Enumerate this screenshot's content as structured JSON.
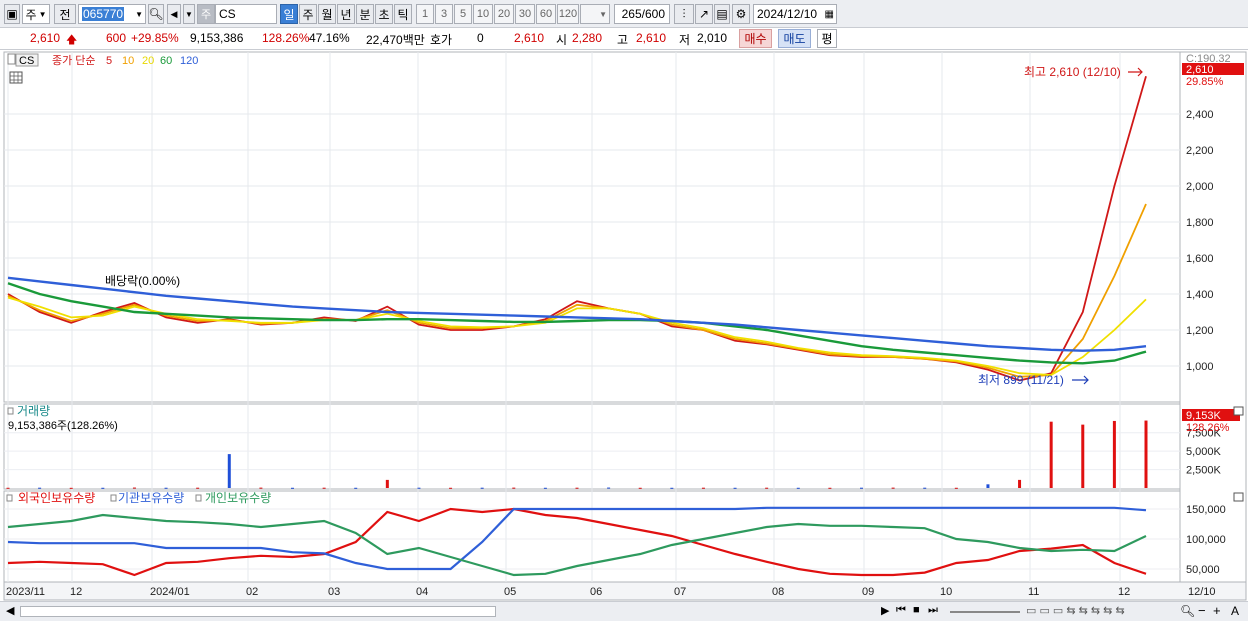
{
  "toolbar": {
    "market_label": "주",
    "prev_label": "전",
    "code_value": "065770",
    "stock_tag": "주",
    "name_value": "CS",
    "periods": [
      "일",
      "주",
      "월",
      "년",
      "분",
      "초",
      "틱"
    ],
    "intervals": [
      "1",
      "3",
      "5",
      "10",
      "20",
      "30",
      "60",
      "120"
    ],
    "count_value": "265",
    "count_total": "/600",
    "date_value": "2024/12/10"
  },
  "quote": {
    "price": "2,610",
    "change": "600",
    "change_pct": "+29.85%",
    "volume": "9,153,386",
    "volume_ratio": "128.26%",
    "turnover": "47.16%",
    "amount": "22,470백만",
    "hoga_label": "호가",
    "hoga_value": "0",
    "hoga_price": "2,610",
    "open_label": "시",
    "open_value": "2,280",
    "high_label": "고",
    "high_value": "2,610",
    "low_label": "저",
    "low_value": "2,010",
    "buy_label": "매수",
    "sell_label": "매도",
    "eval_label": "평"
  },
  "price_panel": {
    "title": "CS",
    "ma_label": "종가 단순",
    "ma_periods": [
      "5",
      "10",
      "20",
      "60",
      "120"
    ],
    "dividend_label": "배당락(0.00%)",
    "high_note": "최고 2,610 (12/10)",
    "low_note": "최저 899 (11/21)",
    "right_top": "C:190.32",
    "last_price_tag": "2,610",
    "last_pct_tag": "29.85%"
  },
  "volume_panel": {
    "title": "거래량",
    "subtitle": "9,153,386주(128.26%)",
    "last_tag": "9,153K",
    "last_pct": "128.26%"
  },
  "holdings_panel": {
    "legend": [
      "외국인보유수량",
      "기관보유수량",
      "개인보유수량"
    ]
  },
  "colors": {
    "up": "#e01010",
    "down": "#1f4fd8",
    "ma5": "#d01818",
    "ma10": "#f0a000",
    "ma20": "#f0e000",
    "ma60": "#1a9a3a",
    "ma120": "#2f5fd8",
    "foreign": "#e01010",
    "institution": "#2f5fd8",
    "individual": "#2e9a5e"
  },
  "chart_data": [
    {
      "type": "line",
      "title": "CS",
      "x_ticks": [
        "2023/11",
        "12",
        "2024/01",
        "02",
        "03",
        "04",
        "05",
        "06",
        "07",
        "08",
        "09",
        "10",
        "11",
        "12",
        "12/10"
      ],
      "y_ticks": [
        1000,
        1200,
        1400,
        1600,
        1800,
        2000,
        2200,
        2400
      ],
      "ylim": [
        800,
        2700
      ],
      "series": [
        {
          "name": "5",
          "values": [
            1400,
            1300,
            1240,
            1300,
            1350,
            1270,
            1240,
            1260,
            1230,
            1240,
            1270,
            1250,
            1330,
            1230,
            1200,
            1200,
            1220,
            1260,
            1360,
            1320,
            1290,
            1220,
            1200,
            1140,
            1120,
            1090,
            1060,
            1050,
            1050,
            1040,
            1020,
            980,
            920,
            960,
            1300,
            2000,
            2610
          ]
        },
        {
          "name": "10",
          "values": [
            1390,
            1310,
            1250,
            1290,
            1340,
            1280,
            1250,
            1255,
            1235,
            1240,
            1260,
            1255,
            1310,
            1240,
            1210,
            1210,
            1220,
            1250,
            1340,
            1320,
            1290,
            1230,
            1200,
            1150,
            1125,
            1095,
            1065,
            1055,
            1050,
            1040,
            1025,
            990,
            940,
            950,
            1150,
            1500,
            1900
          ]
        },
        {
          "name": "20",
          "values": [
            1380,
            1330,
            1270,
            1280,
            1330,
            1290,
            1260,
            1250,
            1240,
            1240,
            1255,
            1255,
            1290,
            1250,
            1220,
            1215,
            1220,
            1240,
            1320,
            1320,
            1290,
            1240,
            1210,
            1160,
            1135,
            1100,
            1075,
            1060,
            1055,
            1045,
            1030,
            1000,
            960,
            950,
            1050,
            1200,
            1370
          ]
        },
        {
          "name": "60",
          "values": [
            1460,
            1400,
            1360,
            1330,
            1300,
            1290,
            1280,
            1270,
            1265,
            1260,
            1255,
            1255,
            1260,
            1260,
            1255,
            1250,
            1245,
            1245,
            1250,
            1255,
            1255,
            1250,
            1240,
            1220,
            1200,
            1170,
            1140,
            1110,
            1090,
            1075,
            1060,
            1045,
            1030,
            1020,
            1015,
            1030,
            1080
          ]
        },
        {
          "name": "120",
          "values": [
            1490,
            1470,
            1450,
            1430,
            1410,
            1390,
            1375,
            1360,
            1345,
            1330,
            1320,
            1310,
            1300,
            1295,
            1290,
            1285,
            1280,
            1275,
            1270,
            1265,
            1260,
            1250,
            1240,
            1230,
            1215,
            1200,
            1185,
            1170,
            1155,
            1140,
            1125,
            1110,
            1100,
            1090,
            1085,
            1090,
            1110
          ]
        }
      ]
    },
    {
      "type": "bar",
      "title": "거래량",
      "y_ticks": [
        "2,500K",
        "5,000K",
        "7,500K"
      ],
      "ylim": [
        0,
        9500000
      ],
      "values": [
        30000,
        40000,
        25000,
        30000,
        60000,
        35000,
        40000,
        4600000,
        50000,
        30000,
        40000,
        30000,
        1100000,
        40000,
        30000,
        40000,
        50000,
        30000,
        40000,
        60000,
        30000,
        30000,
        40000,
        30000,
        40000,
        30000,
        30000,
        40000,
        50000,
        40000,
        30000,
        500000,
        1100000,
        9000000,
        8600000,
        9100000,
        9153386
      ]
    },
    {
      "type": "line",
      "title": "외국인보유수량",
      "y_ticks": [
        50000,
        100000,
        150000
      ],
      "ylim": [
        30000,
        175000
      ],
      "series": [
        {
          "name": "외국인보유수량",
          "values": [
            60000,
            62000,
            60000,
            58000,
            40000,
            60000,
            62000,
            68000,
            72000,
            70000,
            75000,
            95000,
            145000,
            130000,
            150000,
            145000,
            150000,
            140000,
            135000,
            125000,
            115000,
            105000,
            90000,
            75000,
            62000,
            50000,
            42000,
            40000,
            40000,
            44000,
            60000,
            65000,
            80000,
            84000,
            90000,
            60000,
            42000
          ]
        },
        {
          "name": "기관보유수량",
          "values": [
            95000,
            93000,
            93000,
            93000,
            93000,
            85000,
            85000,
            85000,
            85000,
            78000,
            76000,
            60000,
            50000,
            50000,
            50000,
            95000,
            150000,
            150000,
            150000,
            150000,
            150000,
            150000,
            150000,
            150000,
            152000,
            152000,
            152000,
            152000,
            152000,
            152000,
            152000,
            152000,
            152000,
            152000,
            152000,
            152000,
            148000
          ]
        },
        {
          "name": "개인보유수량",
          "values": [
            120000,
            125000,
            130000,
            140000,
            135000,
            130000,
            128000,
            125000,
            120000,
            125000,
            130000,
            110000,
            75000,
            85000,
            70000,
            55000,
            40000,
            42000,
            55000,
            65000,
            75000,
            90000,
            100000,
            110000,
            120000,
            125000,
            122000,
            122000,
            120000,
            118000,
            100000,
            95000,
            85000,
            80000,
            82000,
            80000,
            105000
          ]
        }
      ]
    }
  ]
}
